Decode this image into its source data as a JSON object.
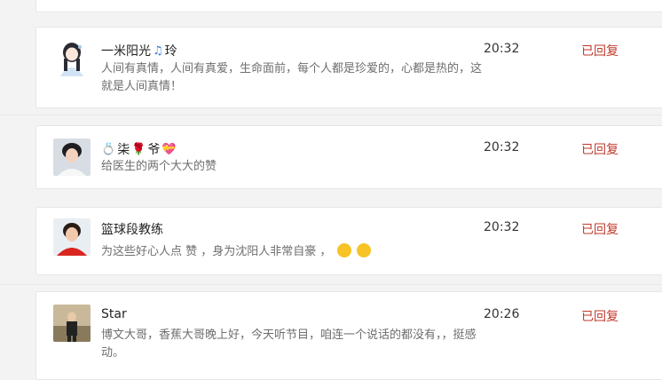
{
  "comments": [
    {
      "name": "一米阳光",
      "name_suffix": "玲",
      "time": "20:32",
      "status": "已回复",
      "text": "人间有真情，人间有真爱，生命面前，每个人都是珍爱的，心都是热的，这就是人间真情！"
    },
    {
      "name_prefix_icon": "ring-emoji",
      "name": "柒",
      "name_mid_icon": "rose-emoji",
      "name_suffix": "爷",
      "name_end_icon": "heart-gift-emoji",
      "time": "20:32",
      "status": "已回复",
      "text": "给医生的两个大大的赞"
    },
    {
      "name": "篮球段教练",
      "time": "20:32",
      "status": "已回复",
      "text": "为这些好心人点 赞 ，身为沈阳人非常自豪 ，",
      "trailing_icons": [
        "clapping-face-emoji",
        "clapping-face-emoji"
      ]
    },
    {
      "name": "Star",
      "time": "20:26",
      "status": "已回复",
      "text": "博文大哥，香蕉大哥晚上好，今天听节目，咱连一个说话的都没有，，挺感动。"
    }
  ]
}
